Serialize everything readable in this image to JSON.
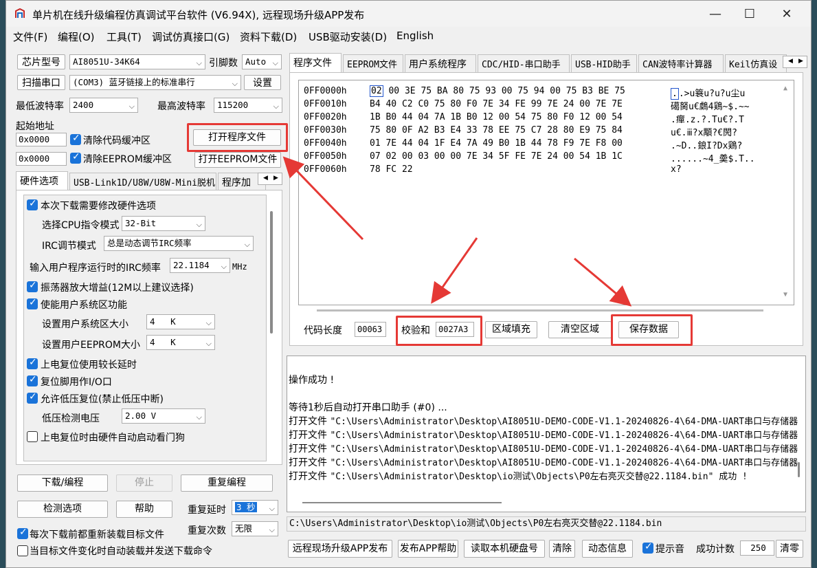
{
  "window": {
    "title": "单片机在线升级编程仿真调试平台软件 (V6.94X), 远程现场升级APP发布",
    "minimize_icon": "minimize-icon",
    "maximize_icon": "maximize-icon",
    "close_icon": "close-icon"
  },
  "menu": [
    "文件(F)",
    "编程(O)",
    "工具(T)",
    "调试仿真接口(G)",
    "资料下载(D)",
    "USB驱动安装(D)",
    "English"
  ],
  "left": {
    "chip_label": "芯片型号",
    "chip_value": "AI8051U-34K64",
    "pin_label": "引脚数",
    "pin_value": "Auto",
    "scan_port_label": "扫描串口",
    "port_value": "(COM3) 蓝牙链接上的标准串行",
    "settings_label": "设置",
    "min_baud_label": "最低波特率",
    "min_baud_value": "2400",
    "max_baud_label": "最高波特率",
    "max_baud_value": "115200",
    "start_addr_label": "起始地址",
    "code_addr": "0x0000",
    "clear_code_label": "清除代码缓冲区",
    "eeprom_addr": "0x0000",
    "clear_eeprom_label": "清除EEPROM缓冲区",
    "open_program_label": "打开程序文件",
    "open_eeprom_label": "打开EEPROM文件",
    "tabs": [
      "硬件选项",
      "USB-Link1D/U8W/U8W-Mini脱机",
      "程序加"
    ],
    "hw": {
      "modify_hw_label": "本次下载需要修改硬件选项",
      "cpu_mode_label": "选择CPU指令模式",
      "cpu_mode_value": "32-Bit",
      "irc_mode_label": "IRC调节模式",
      "irc_mode_value": "总是动态调节IRC频率",
      "irc_freq_label": "输入用户程序运行时的IRC频率",
      "irc_freq_value": "22.1184",
      "irc_unit": "MHz",
      "osc_gain_label": "振荡器放大增益(12M以上建议选择)",
      "user_sys_label": "使能用户系统区功能",
      "sys_size_label": "设置用户系统区大小",
      "sys_size_value": "4   K",
      "eeprom_size_label": "设置用户EEPROM大小",
      "eeprom_size_value": "4   K",
      "power_reset_label": "上电复位使用较长延时",
      "reset_io_label": "复位脚用作I/O口",
      "lvr_label": "允许低压复位(禁止低压中断)",
      "lv_label": "低压检测电压",
      "lv_value": "2.00 V",
      "wdt_label": "上电复位时由硬件自动启动看门狗"
    },
    "download_label": "下载/编程",
    "stop_label": "停止",
    "repeat_program_label": "重复编程",
    "check_option_label": "检测选项",
    "help_label": "帮助",
    "repeat_delay_label": "重复延时",
    "repeat_delay_value": "3 秒",
    "repeat_count_label": "重复次数",
    "repeat_count_value": "无限",
    "reload_label": "每次下载前都重新装载目标文件",
    "auto_reload_label": "当目标文件变化时自动装载并发送下载命令"
  },
  "right": {
    "tabs": [
      "程序文件",
      "EEPROM文件",
      "用户系统程序",
      "CDC/HID-串口助手",
      "USB-HID助手",
      "CAN波特率计算器",
      "Keil仿真设"
    ],
    "hex": [
      {
        "addr": "0FF0000h",
        "first": "02",
        "bytes": "00 3E 75 BA 80 75 93 00 75 94 00 75 B3 BE 75",
        "ascii_first": ".",
        "ascii": ".>u簔u?u?u尘u"
      },
      {
        "addr": "0FF0010h",
        "first": "",
        "bytes": "B4 40 C2 C0 75 80 F0 7E 34 FE 99 7E 24 00 7E 7E",
        "ascii_first": "",
        "ascii": "礍胬u€鸆4鶏~$.~~"
      },
      {
        "addr": "0FF0020h",
        "first": "",
        "bytes": "1B B0 44 04 7A 1B B0 12 00 54 75 80 F0 12 00 54",
        "ascii_first": "",
        "ascii": ".癉.z.?.Tu€?.T"
      },
      {
        "addr": "0FF0030h",
        "first": "",
        "bytes": "75 80 0F A2 B3 E4 33 78 EE 75 C7 28 80 E9 75 84",
        "ascii_first": "",
        "ascii": "u€.ⅲ?x顒?€閌?"
      },
      {
        "addr": "0FF0040h",
        "first": "",
        "bytes": "01 7E 44 04 1F E4 7A 49 B0 1B 44 78 F9 7E F8 00",
        "ascii_first": "",
        "ascii": ".~D..鋃I?Dx鶏?"
      },
      {
        "addr": "0FF0050h",
        "first": "",
        "bytes": "07 02 00 03 00 00 7E 34 5F FE 7E 24 00 54 1B 1C",
        "ascii_first": "",
        "ascii": "......~4_羮$.T.."
      },
      {
        "addr": "0FF0060h",
        "first": "",
        "bytes": "78 FC 22",
        "ascii_first": "",
        "ascii": "x?"
      }
    ],
    "code_len_label": "代码长度",
    "code_len_value": "00063",
    "checksum_label": "校验和",
    "checksum_value": "0027A3",
    "fill_label": "区域填充",
    "clear_area_label": "清空区域",
    "save_data_label": "保存数据",
    "log": [
      {
        "text": "操作成功 !",
        "mono": ""
      },
      {
        "text": "",
        "mono": ""
      },
      {
        "text": "等待1秒后自动打开串口助手 (#0) ...",
        "mono": ""
      },
      {
        "text": "打开文件 ",
        "mono": "\"C:\\Users\\Administrator\\Desktop\\AI8051U-DEMO-CODE-V1.1-20240826-4\\64-DMA-UART串口与存储器"
      },
      {
        "text": "打开文件 ",
        "mono": "\"C:\\Users\\Administrator\\Desktop\\AI8051U-DEMO-CODE-V1.1-20240826-4\\64-DMA-UART串口与存储器"
      },
      {
        "text": "打开文件 ",
        "mono": "\"C:\\Users\\Administrator\\Desktop\\AI8051U-DEMO-CODE-V1.1-20240826-4\\64-DMA-UART串口与存储器"
      },
      {
        "text": "打开文件 ",
        "mono": "\"C:\\Users\\Administrator\\Desktop\\AI8051U-DEMO-CODE-V1.1-20240826-4\\64-DMA-UART串口与存储器"
      },
      {
        "text": "打开文件 ",
        "mono": "\"C:\\Users\\Administrator\\Desktop\\io测试\\Objects\\P0左右亮灭交替@22.1184.bin\" 成功 !"
      }
    ],
    "status_path": "C:\\Users\\Administrator\\Desktop\\io测试\\Objects\\P0左右亮灭交替@22.1184.bin",
    "remote_app_label": "远程现场升级APP发布",
    "publish_help_label": "发布APP帮助",
    "read_disk_label": "读取本机硬盘号",
    "clear_label": "清除",
    "dynamic_info_label": "动态信息",
    "beep_label": "提示音",
    "success_count_label": "成功计数",
    "success_count_value": "250",
    "clear_zero_label": "清零"
  },
  "colors": {
    "highlight": "#e53935",
    "accent": "#1a73d9"
  }
}
